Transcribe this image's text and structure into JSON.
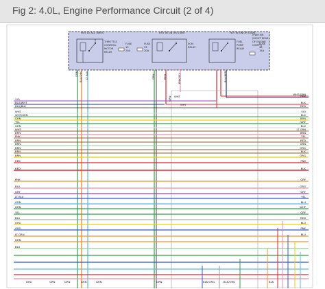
{
  "header": {
    "title": "Fig 2: 4.0L, Engine Performance Circuit (2 of 4)"
  },
  "power_box": {
    "hot_labels": [
      "HOT AT ALL TIMES",
      "HOT IN ON OR START",
      "HOT IN ON OR START"
    ],
    "components": {
      "throttle_relay": "THROTTLE CONTROL MOTOR RELAY",
      "fuse_a": "FUSE 13 20A",
      "fuse_b": "FUSE 33 20A",
      "ecm_relay": "ECM RELAY",
      "fuel_pump_relay": "FUEL PUMP RELAY",
      "fuse_c": "FUSE 48 15A",
      "pdm_note": "PDM E/R (RIGHT REAR OF ENGINE COMPT)"
    },
    "wire_tags": [
      "GRN",
      "BLU/ORG",
      "LT BLU",
      "GRN",
      "RED",
      "PNK/YEL",
      "BLU/RED"
    ]
  },
  "left_labels": [
    {
      "num": "",
      "text": "VIO"
    },
    {
      "num": "",
      "text": "BLU/WHT"
    },
    {
      "num": "",
      "text": "BLU/BLK"
    },
    {
      "num": "",
      "text": "WHT"
    },
    {
      "num": "",
      "text": "WHT/GRN"
    },
    {
      "num": "",
      "text": "GRN"
    },
    {
      "num": "",
      "text": "YEL"
    },
    {
      "num": "",
      "text": "GRN"
    },
    {
      "num": "",
      "text": "WHT"
    },
    {
      "num": "",
      "text": "BRN"
    },
    {
      "num": "",
      "text": "PNK"
    },
    {
      "num": "",
      "text": "BRN"
    },
    {
      "num": "",
      "text": "BRN"
    },
    {
      "num": "",
      "text": "BRN"
    },
    {
      "num": "",
      "text": "BRN"
    },
    {
      "num": "",
      "text": "BRN"
    },
    {
      "num": "",
      "text": "RED"
    },
    {
      "num": "",
      "text": "RED"
    },
    {
      "num": "",
      "text": "PNK"
    },
    {
      "num": "",
      "text": "BLU"
    },
    {
      "num": "",
      "text": "GRY"
    },
    {
      "num": "",
      "text": "LT BLU"
    },
    {
      "num": "",
      "text": "GRN"
    },
    {
      "num": "",
      "text": "GRN"
    },
    {
      "num": "",
      "text": "YEL"
    },
    {
      "num": "",
      "text": "BLU"
    },
    {
      "num": "",
      "text": "ORG"
    },
    {
      "num": "",
      "text": "ORG"
    },
    {
      "num": "",
      "text": "LT GRN"
    },
    {
      "num": "",
      "text": "GRN"
    },
    {
      "num": "",
      "text": "BLU"
    }
  ],
  "right_labels": [
    {
      "num": "",
      "text": "WHT/GRN"
    },
    {
      "num": "",
      "text": "RED"
    },
    {
      "num": "",
      "text": "BLK"
    },
    {
      "num": "",
      "text": "RED"
    },
    {
      "num": "",
      "text": "VIO"
    },
    {
      "num": "",
      "text": "BLK"
    },
    {
      "num": "",
      "text": "BRN"
    },
    {
      "num": "",
      "text": "GRY"
    },
    {
      "num": "",
      "text": "BLK"
    },
    {
      "num": "",
      "text": "LT GRN"
    },
    {
      "num": "",
      "text": "BRN"
    },
    {
      "num": "",
      "text": "YEL"
    },
    {
      "num": "",
      "text": "RED"
    },
    {
      "num": "",
      "text": "GRN"
    },
    {
      "num": "",
      "text": "ORG"
    },
    {
      "num": "",
      "text": "BLK"
    },
    {
      "num": "",
      "text": "ORG"
    },
    {
      "num": "",
      "text": "PNK"
    },
    {
      "num": "",
      "text": "BLK"
    },
    {
      "num": "",
      "text": "GRY"
    },
    {
      "num": "",
      "text": "ORG"
    },
    {
      "num": "",
      "text": "GRY"
    },
    {
      "num": "",
      "text": "YEL"
    },
    {
      "num": "",
      "text": "BLU"
    },
    {
      "num": "",
      "text": "WHT"
    },
    {
      "num": "",
      "text": "GRY"
    },
    {
      "num": "",
      "text": "RED"
    },
    {
      "num": "",
      "text": "BLU"
    },
    {
      "num": "",
      "text": "PNK"
    },
    {
      "num": "",
      "text": "BLU"
    }
  ],
  "bottom_tags": [
    "ORG",
    "GRN",
    "GRN",
    "GRN",
    "GRN",
    "GRN",
    "BLK/ORG",
    "BLK/ORG",
    "BLK"
  ],
  "mid_tags": [
    "WHT",
    "WHT",
    "GRN"
  ],
  "colors": {
    "green": "#2ea043",
    "red": "#e5262e",
    "blue": "#2f55d4",
    "yellow": "#f0d000",
    "orange": "#f09030",
    "pink": "#f08aa8",
    "violet": "#9a3fc8",
    "black": "#1a1a1a",
    "brown": "#8b5a2b",
    "gray": "#9a9a9a",
    "ltblue": "#5ab7e8",
    "ltgreen": "#8fd28f",
    "white": "#d6d6d6",
    "navy": "#1c2e8c",
    "box": "#c9cdea"
  }
}
